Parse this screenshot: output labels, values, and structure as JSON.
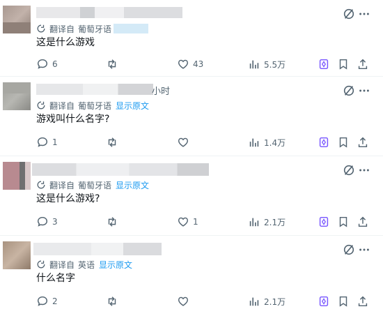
{
  "replies": [
    {
      "translation_label": "翻译自",
      "language": "葡萄牙语",
      "show_original": "",
      "text": "这是什么游戏",
      "time_suffix": "",
      "stats": {
        "comments": "6",
        "reposts": "",
        "likes": "43",
        "views": "5.5万"
      }
    },
    {
      "translation_label": "翻译自",
      "language": "葡萄牙语",
      "show_original": "显示原文",
      "text": "游戏叫什么名字?",
      "time_suffix": "小时",
      "stats": {
        "comments": "1",
        "reposts": "",
        "likes": "",
        "views": "1.4万"
      }
    },
    {
      "translation_label": "翻译自",
      "language": "葡萄牙语",
      "show_original": "显示原文",
      "text": "这是什么游戏?",
      "time_suffix": "",
      "stats": {
        "comments": "3",
        "reposts": "",
        "likes": "1",
        "views": "2.1万"
      }
    },
    {
      "translation_label": "翻译自",
      "language": "英语",
      "show_original": "显示原文",
      "text": "什么名字",
      "time_suffix": "",
      "stats": {
        "comments": "2",
        "reposts": "",
        "likes": "",
        "views": "2.1万"
      }
    }
  ],
  "colors": {
    "accent": "#1d9bf0",
    "muted": "#536471",
    "grok": "#7856ff"
  },
  "icons": {
    "reply": "comment-icon",
    "repost": "repost-icon",
    "like": "heart-icon",
    "views": "views-icon",
    "grok": "grok-icon",
    "bookmark": "bookmark-icon",
    "share": "share-icon",
    "hide": "hide-icon",
    "more": "more-icon",
    "translate": "translate-icon"
  }
}
